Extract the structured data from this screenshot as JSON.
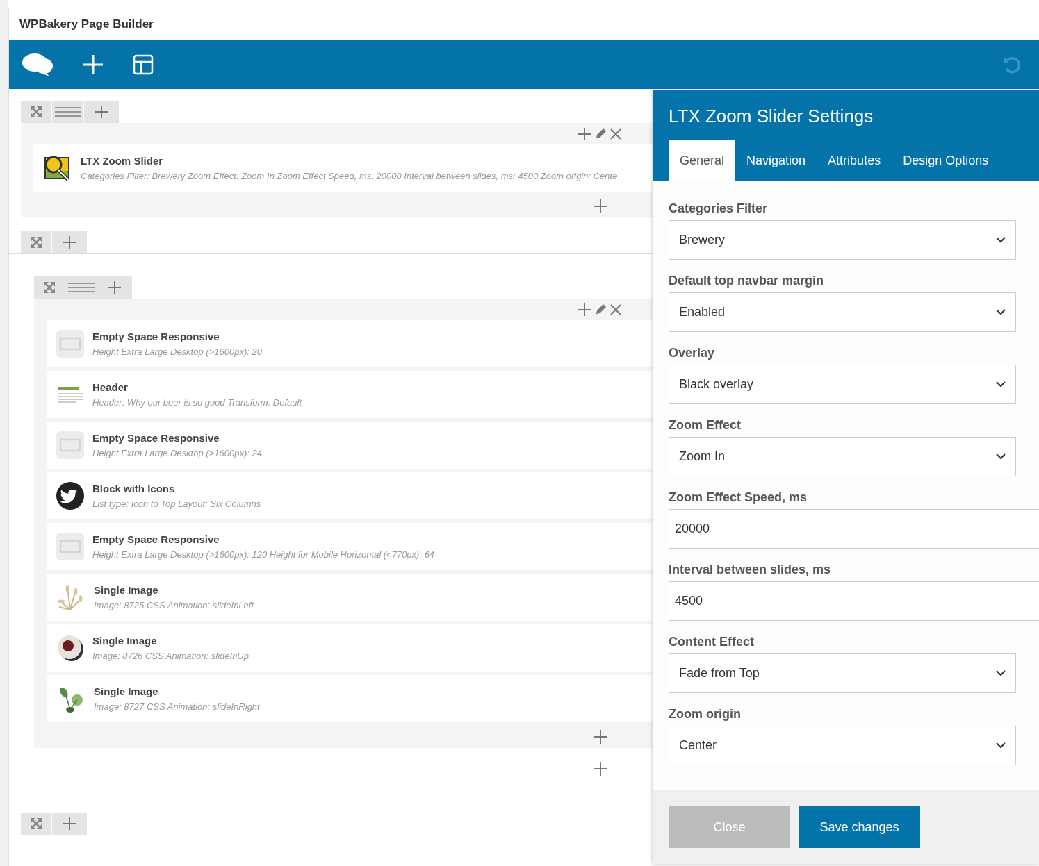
{
  "window": {
    "title": "WPBakery Page Builder"
  },
  "toolbar": {
    "left": [
      {
        "kind": "logo"
      },
      {
        "kind": "add"
      },
      {
        "kind": "layout"
      }
    ],
    "right": [
      {
        "kind": "undo",
        "disabled": true
      }
    ]
  },
  "canvas": {
    "rows": [
      {
        "controls": [
          {
            "kind": "move"
          },
          {
            "kind": "drag"
          },
          {
            "kind": "add"
          }
        ],
        "columns": [
          {
            "elements": [
              {
                "kind": "zoom-slider",
                "title": "LTX Zoom Slider",
                "params": "Categories Filter: Brewery  Zoom Effect: Zoom In  Zoom Effect Speed, ms: 20000  Interval between slides, ms: 4500  Zoom origin: Cente"
              }
            ]
          }
        ]
      },
      {
        "controls": [
          {
            "kind": "move"
          },
          {
            "kind": "add"
          }
        ],
        "inner_rows": [
          {
            "controls": [
              {
                "kind": "move"
              },
              {
                "kind": "drag"
              },
              {
                "kind": "add"
              }
            ],
            "columns": [
              {
                "elements": [
                  {
                    "kind": "empty-space",
                    "title": "Empty Space Responsive",
                    "params": "Height Extra Large Desktop (>1600px): 20"
                  },
                  {
                    "kind": "header",
                    "title": "Header",
                    "params": "Header: Why our beer is so good  Transform: Default"
                  },
                  {
                    "kind": "empty-space",
                    "title": "Empty Space Responsive",
                    "params": "Height Extra Large Desktop (>1600px): 24"
                  },
                  {
                    "kind": "social",
                    "title": "Block with Icons",
                    "params": "List type: Icon to Top  Layout: Six Columns"
                  },
                  {
                    "kind": "empty-space",
                    "title": "Empty Space Responsive",
                    "params": "Height Extra Large Desktop (>1600px): 120  Height for Mobile Horizontal (<770px): 64"
                  },
                  {
                    "kind": "image-wheat",
                    "title": "Single Image",
                    "params": "Image: 8725  CSS Animation: slideInLeft"
                  },
                  {
                    "kind": "image-bowl",
                    "title": "Single Image",
                    "params": "Image: 8726  CSS Animation: slideInUp"
                  },
                  {
                    "kind": "image-leaf",
                    "title": "Single Image",
                    "params": "Image: 8727  CSS Animation: slideInRight"
                  }
                ]
              }
            ]
          }
        ]
      },
      {
        "controls": [
          {
            "kind": "move"
          },
          {
            "kind": "add"
          }
        ]
      }
    ]
  },
  "panel": {
    "title": "LTX Zoom Slider Settings",
    "tabs": [
      {
        "label": "General",
        "selected": true
      },
      {
        "label": "Navigation",
        "selected": false
      },
      {
        "label": "Attributes",
        "selected": false
      },
      {
        "label": "Design Options",
        "selected": false
      }
    ],
    "fields": [
      {
        "kind": "select",
        "label": "Categories Filter",
        "value": "Brewery"
      },
      {
        "kind": "select",
        "label": "Default top navbar margin",
        "value": "Enabled"
      },
      {
        "kind": "select",
        "label": "Overlay",
        "value": "Black overlay"
      },
      {
        "kind": "select",
        "label": "Zoom Effect",
        "value": "Zoom In"
      },
      {
        "kind": "text",
        "label": "Zoom Effect Speed, ms",
        "value": "20000"
      },
      {
        "kind": "text",
        "label": "Interval between slides, ms",
        "value": "4500"
      },
      {
        "kind": "select",
        "label": "Content Effect",
        "value": "Fade from Top"
      },
      {
        "kind": "select",
        "label": "Zoom origin",
        "value": "Center"
      }
    ],
    "buttons": [
      {
        "kind": "secondary",
        "label": "Close"
      },
      {
        "kind": "primary",
        "label": "Save changes"
      }
    ]
  }
}
